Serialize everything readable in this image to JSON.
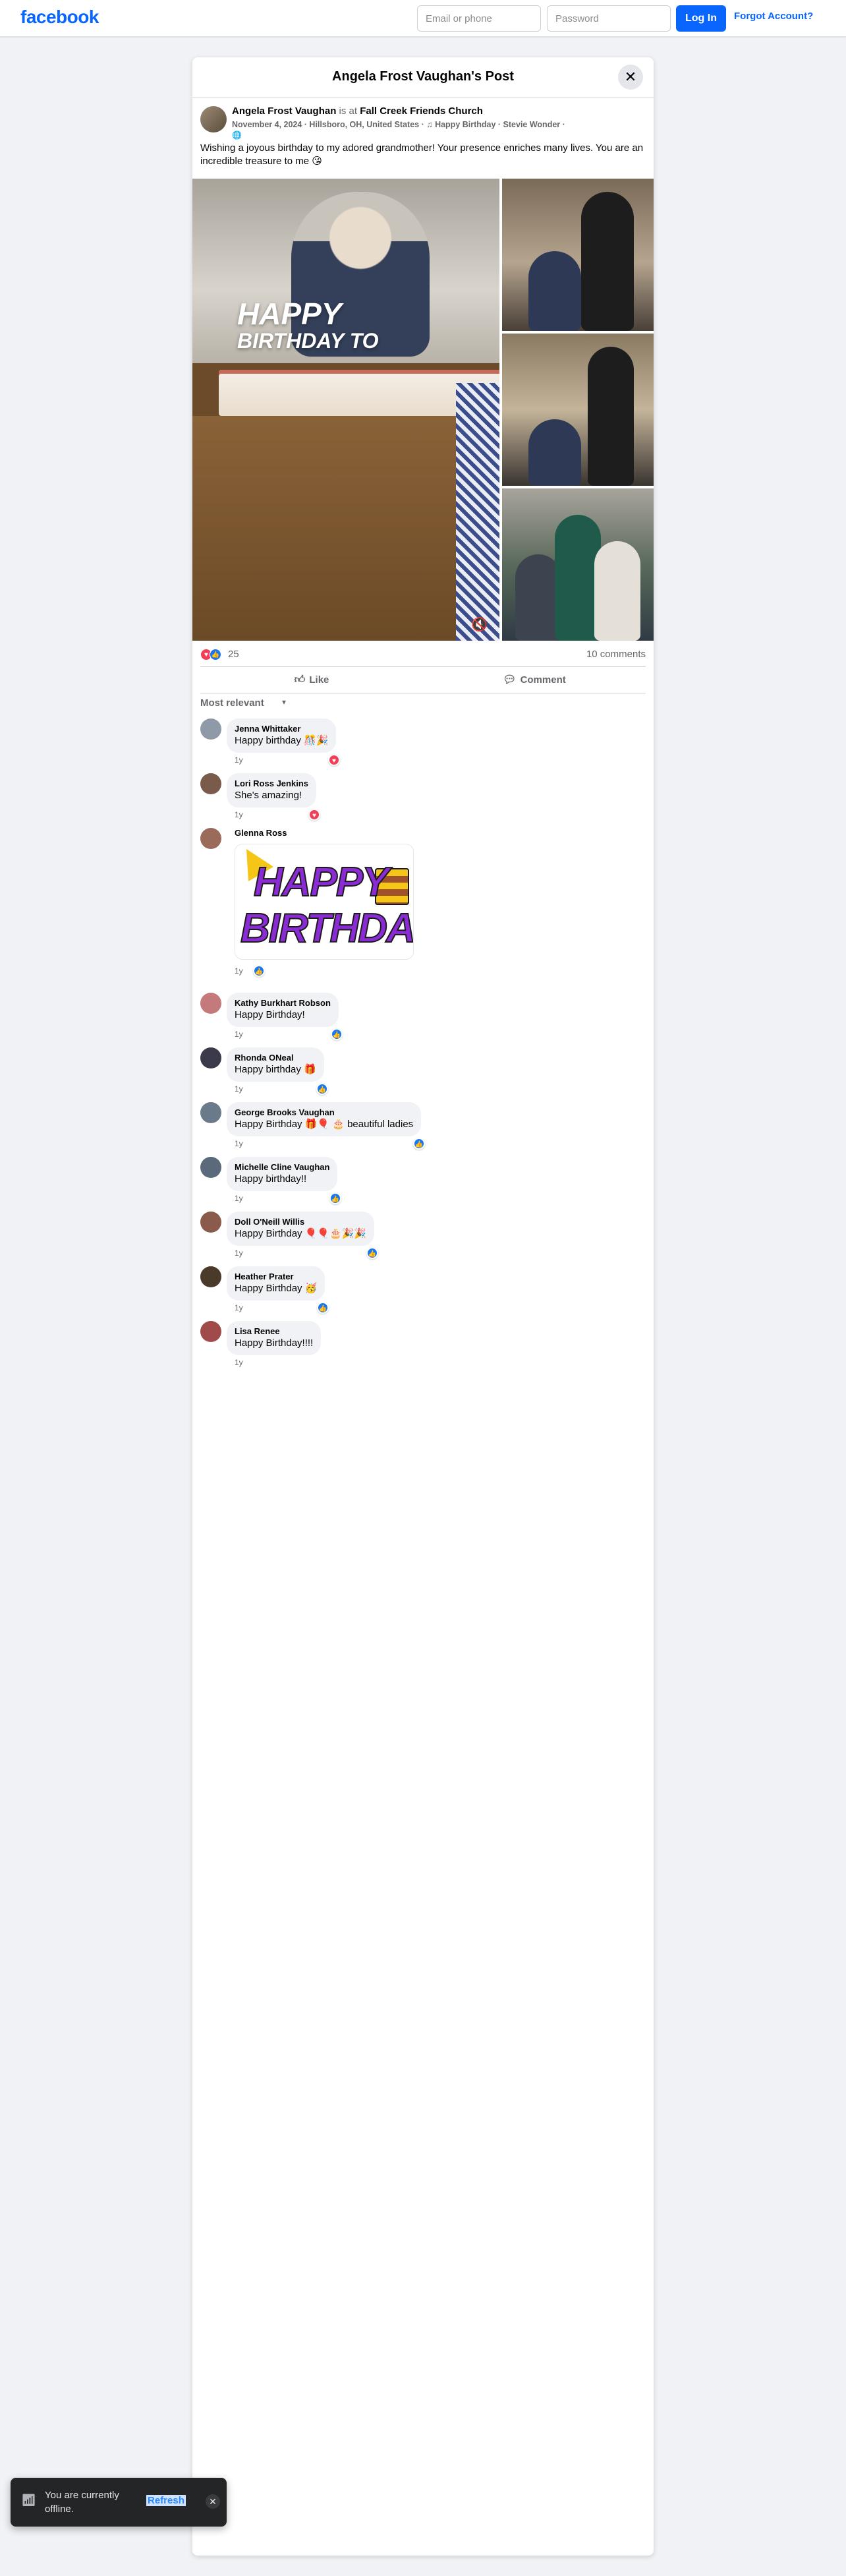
{
  "topbar": {
    "logo": "facebook",
    "email_placeholder": "Email or phone",
    "password_placeholder": "Password",
    "login_label": "Log In",
    "forgot_label": "Forgot Account?"
  },
  "dialog": {
    "title": "Angela Frost Vaughan's Post",
    "close_icon": "close-icon"
  },
  "post": {
    "author": "Angela Frost Vaughan",
    "is_at": "is at",
    "place": "Fall Creek Friends Church",
    "meta": "November 4, 2024 · Hillsboro, OH, United States · ♫ Happy Birthday · Stevie Wonder ·",
    "privacy_icon": "globe-icon",
    "text": "Wishing a joyous birthday to my adored grandmother! Your presence enriches many lives. You are an incredible treasure to me 😘",
    "overlay_line1": "HAPPY",
    "overlay_line2": "BIRTHDAY TO",
    "reaction_count": "25",
    "comment_count": "10 comments",
    "like_label": "Like",
    "comment_label": "Comment",
    "sort_label": "Most relevant"
  },
  "comments": [
    {
      "name": "Jenna Whittaker",
      "text": "Happy birthday 🎊🎉",
      "time": "1y",
      "reaction": "love",
      "avatar_color": "#8e9aa8"
    },
    {
      "name": "Lori Ross Jenkins",
      "text": "She's amazing!",
      "time": "1y",
      "reaction": "love",
      "avatar_color": "#7a5a4a"
    },
    {
      "name": "Glenna Ross",
      "text": "",
      "time": "1y",
      "reaction": "like",
      "avatar_color": "#9a6a5a",
      "sticker_line1": "HAPPY",
      "sticker_line2": "BIRTHDAY"
    },
    {
      "name": "Kathy Burkhart Robson",
      "text": "Happy Birthday!",
      "time": "1y",
      "reaction": "like",
      "avatar_color": "#c47a7a"
    },
    {
      "name": "Rhonda ONeal",
      "text": "Happy birthday 🎁",
      "time": "1y",
      "reaction": "like",
      "avatar_color": "#3a3a4a"
    },
    {
      "name": "George Brooks Vaughan",
      "text": "Happy Birthday 🎁🎈 🎂 beautiful ladies",
      "time": "1y",
      "reaction": "like",
      "avatar_color": "#6a7a8a"
    },
    {
      "name": "Michelle Cline Vaughan",
      "text": "Happy birthday!!",
      "time": "1y",
      "reaction": "like",
      "avatar_color": "#5a6a7a"
    },
    {
      "name": "Doll O'Neill Willis",
      "text": "Happy Birthday 🎈🎈🎂🎉🎉",
      "time": "1y",
      "reaction": "like",
      "avatar_color": "#8a5a4a"
    },
    {
      "name": "Heather Prater",
      "text": "Happy Birthday 🥳",
      "time": "1y",
      "reaction": "like",
      "avatar_color": "#4a3a2a"
    },
    {
      "name": "Lisa Renee",
      "text": "Happy Birthday!!!!",
      "time": "1y",
      "reaction": "",
      "avatar_color": "#a04a4a"
    }
  ],
  "toast": {
    "text": "You are currently offline.",
    "refresh_label": "Refresh"
  },
  "colors": {
    "brand": "#0866ff",
    "love": "#f33e58",
    "like": "#1877f2"
  }
}
